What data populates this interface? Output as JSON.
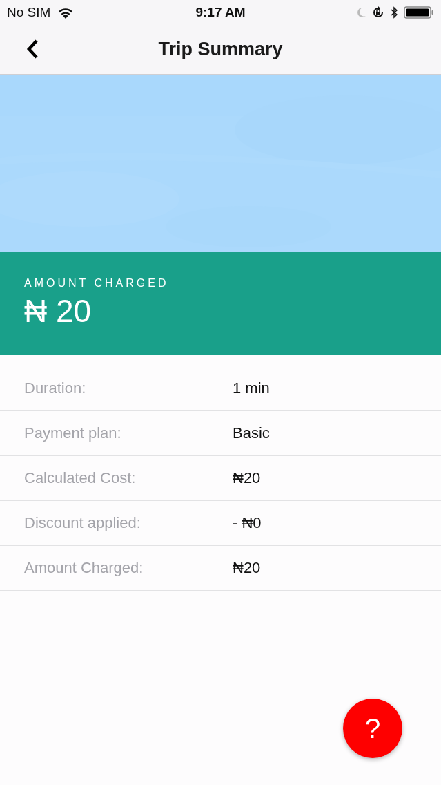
{
  "status_bar": {
    "carrier": "No SIM",
    "time": "9:17 AM"
  },
  "nav": {
    "title": "Trip Summary"
  },
  "amount": {
    "label": "AMOUNT CHARGED",
    "value": "₦ 20"
  },
  "rows": [
    {
      "label": "Duration:",
      "value": "1 min"
    },
    {
      "label": "Payment plan:",
      "value": "Basic"
    },
    {
      "label": "Calculated Cost:",
      "value": "₦20"
    },
    {
      "label": "Discount applied:",
      "value": "- ₦0"
    },
    {
      "label": "Amount Charged:",
      "value": "₦20"
    }
  ],
  "help_button": {
    "label": "?"
  }
}
